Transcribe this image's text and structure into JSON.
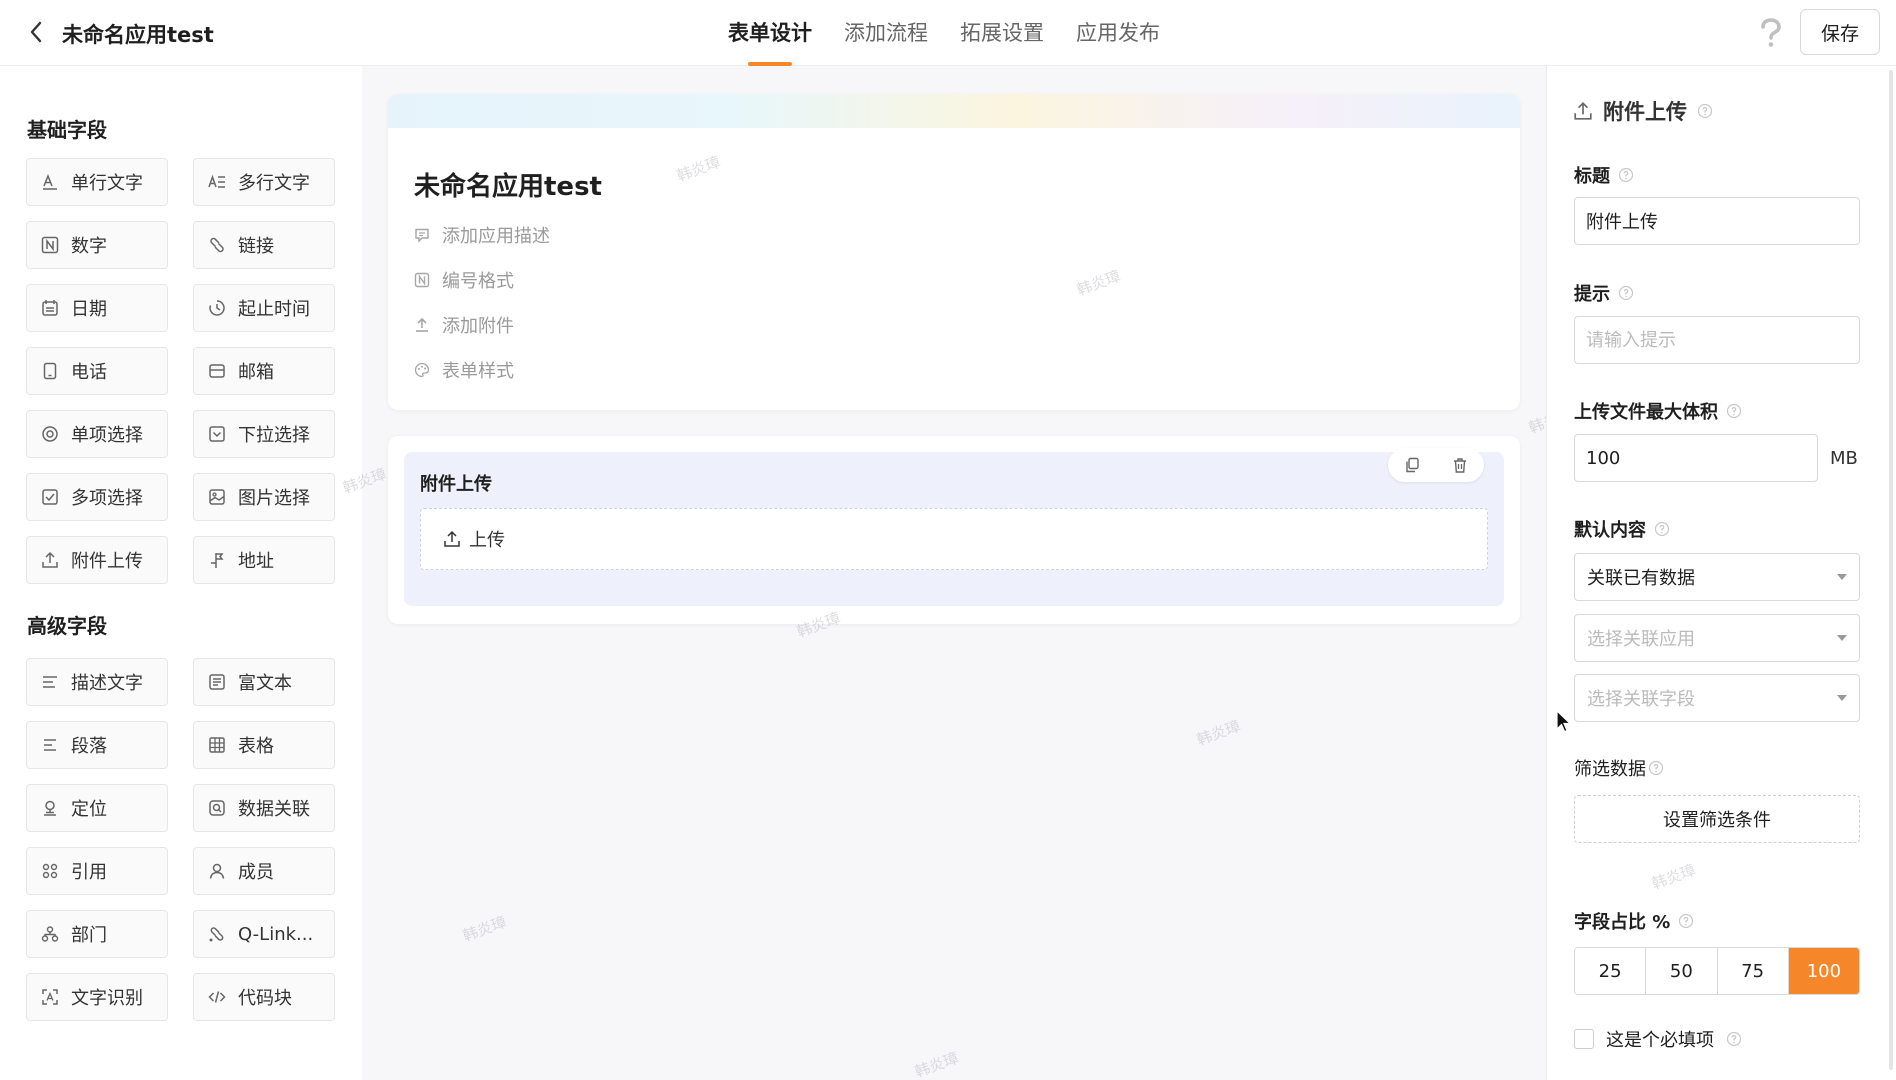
{
  "header": {
    "app_title": "未命名应用test",
    "tabs": [
      "表单设计",
      "添加流程",
      "拓展设置",
      "应用发布"
    ],
    "active_tab": 0,
    "save_label": "保存"
  },
  "left": {
    "basic_title": "基础字段",
    "basic_fields": [
      {
        "label": "单行文字",
        "icon": "single-line-text-icon"
      },
      {
        "label": "多行文字",
        "icon": "multi-line-text-icon"
      },
      {
        "label": "数字",
        "icon": "number-icon"
      },
      {
        "label": "链接",
        "icon": "link-icon"
      },
      {
        "label": "日期",
        "icon": "calendar-icon"
      },
      {
        "label": "起止时间",
        "icon": "time-range-icon"
      },
      {
        "label": "电话",
        "icon": "phone-icon"
      },
      {
        "label": "邮箱",
        "icon": "mail-icon"
      },
      {
        "label": "单项选择",
        "icon": "radio-icon"
      },
      {
        "label": "下拉选择",
        "icon": "dropdown-icon"
      },
      {
        "label": "多项选择",
        "icon": "checkbox-icon"
      },
      {
        "label": "图片选择",
        "icon": "image-icon"
      },
      {
        "label": "附件上传",
        "icon": "upload-icon"
      },
      {
        "label": "地址",
        "icon": "address-icon"
      }
    ],
    "advanced_title": "高级字段",
    "advanced_fields": [
      {
        "label": "描述文字",
        "icon": "description-icon"
      },
      {
        "label": "富文本",
        "icon": "rich-text-icon"
      },
      {
        "label": "段落",
        "icon": "paragraph-icon"
      },
      {
        "label": "表格",
        "icon": "table-icon"
      },
      {
        "label": "定位",
        "icon": "location-icon"
      },
      {
        "label": "数据关联",
        "icon": "data-link-icon"
      },
      {
        "label": "引用",
        "icon": "reference-icon"
      },
      {
        "label": "成员",
        "icon": "member-icon"
      },
      {
        "label": "部门",
        "icon": "department-icon"
      },
      {
        "label": "Q-Link...",
        "icon": "qlink-icon"
      },
      {
        "label": "文字识别",
        "icon": "ocr-icon"
      },
      {
        "label": "代码块",
        "icon": "code-icon"
      }
    ]
  },
  "canvas": {
    "form_title": "未命名应用test",
    "meta_items": [
      {
        "label": "添加应用描述",
        "icon": "comment-icon"
      },
      {
        "label": "编号格式",
        "icon": "number-format-icon"
      },
      {
        "label": "添加附件",
        "icon": "attachment-icon"
      },
      {
        "label": "表单样式",
        "icon": "palette-icon"
      }
    ],
    "field_label": "附件上传",
    "upload_label": "上传",
    "watermark": "韩炎璋"
  },
  "panel": {
    "title": "附件上传",
    "title_label": "标题",
    "title_value": "附件上传",
    "hint_label": "提示",
    "hint_placeholder": "请输入提示",
    "max_size_label": "上传文件最大体积",
    "max_size_value": "100",
    "max_size_unit": "MB",
    "default_label": "默认内容",
    "default_value": "关联已有数据",
    "app_placeholder": "选择关联应用",
    "field_placeholder": "选择关联字段",
    "filter_label": "筛选数据",
    "filter_button": "设置筛选条件",
    "ratio_label": "字段占比 %",
    "ratios": [
      "25",
      "50",
      "75",
      "100"
    ],
    "ratio_active": 3,
    "required_label": "这是个必填项"
  },
  "colors": {
    "accent": "#f5872a",
    "selected_bg": "#eef0fb",
    "canvas_bg": "#f7f7f9"
  }
}
